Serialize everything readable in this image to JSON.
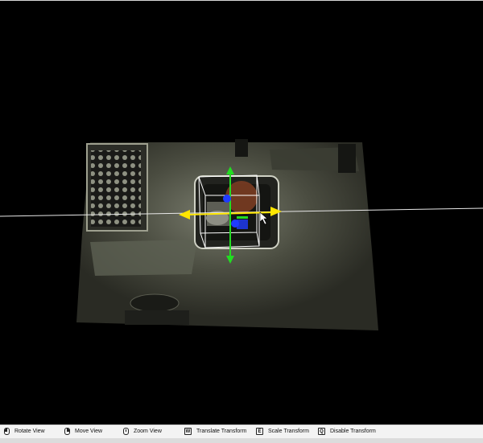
{
  "statusbar": {
    "hints": [
      {
        "icon": "mouse-left-icon",
        "label": "Rotate View"
      },
      {
        "icon": "mouse-right-icon",
        "label": "Move View"
      },
      {
        "icon": "mouse-middle-icon",
        "label": "Zoom View"
      },
      {
        "key": "W",
        "label": "Translate Transform"
      },
      {
        "key": "E",
        "label": "Scale Transform"
      },
      {
        "key": "Q",
        "label": "Disable Transform"
      }
    ]
  },
  "gizmo": {
    "x_axis_color": "#ffe600",
    "y_axis_color": "#22dd22",
    "z_axis_color": "#1f3cff"
  }
}
